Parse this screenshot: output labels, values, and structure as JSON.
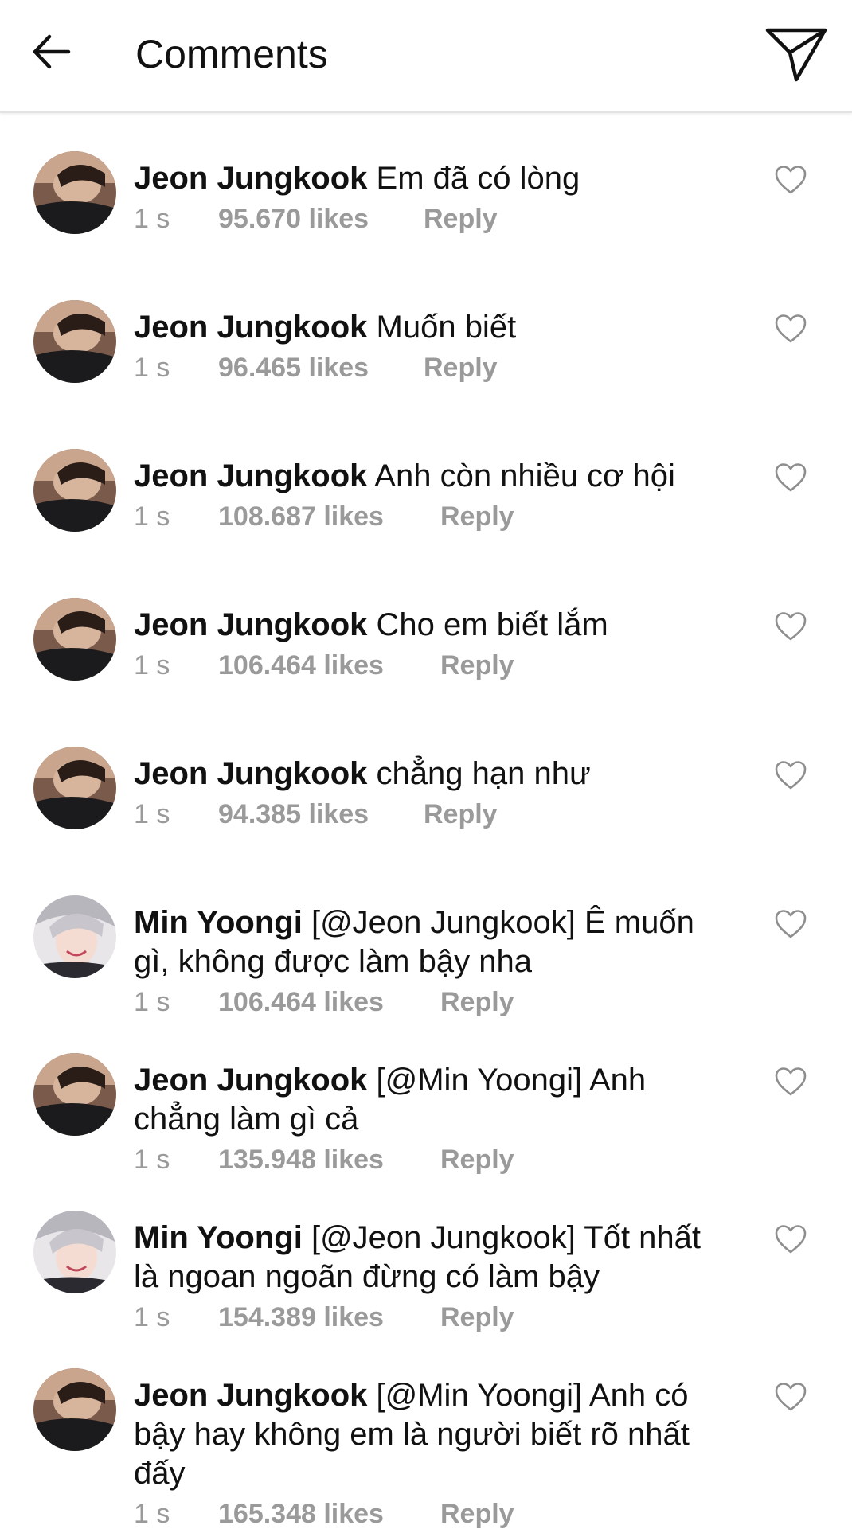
{
  "header": {
    "title": "Comments",
    "back_icon": "arrow-left-icon",
    "send_icon": "paper-plane-icon"
  },
  "colors": {
    "text": "#111111",
    "meta": "#9a9a9a",
    "divider": "#e3e3e3"
  },
  "comments": [
    {
      "username": "Jeon Jungkook",
      "text": "Em đã có lòng",
      "time": "1 s",
      "likes": "95.670 likes",
      "reply": "Reply",
      "avatar": "jungkook-avatar"
    },
    {
      "username": "Jeon Jungkook",
      "text": "Muốn biết",
      "time": "1 s",
      "likes": "96.465 likes",
      "reply": "Reply",
      "avatar": "jungkook-avatar"
    },
    {
      "username": "Jeon Jungkook",
      "text": "Anh còn nhiều cơ hội",
      "time": "1 s",
      "likes": "108.687 likes",
      "reply": "Reply",
      "avatar": "jungkook-avatar"
    },
    {
      "username": "Jeon Jungkook",
      "text": "Cho em biết lắm",
      "time": "1 s",
      "likes": "106.464 likes",
      "reply": "Reply",
      "avatar": "jungkook-avatar"
    },
    {
      "username": "Jeon Jungkook",
      "text": "chẳng hạn như",
      "time": "1 s",
      "likes": "94.385 likes",
      "reply": "Reply",
      "avatar": "jungkook-avatar"
    },
    {
      "username": "Min Yoongi",
      "text": "[@Jeon Jungkook] Ê muốn gì, không được làm bậy nha",
      "time": "1 s",
      "likes": "106.464 likes",
      "reply": "Reply",
      "avatar": "yoongi-avatar"
    },
    {
      "username": "Jeon Jungkook",
      "text": "[@Min Yoongi] Anh chẳng làm gì cả",
      "time": "1 s",
      "likes": "135.948 likes",
      "reply": "Reply",
      "avatar": "jungkook-avatar"
    },
    {
      "username": "Min Yoongi",
      "text": "[@Jeon Jungkook] Tốt nhất là ngoan ngoãn đừng có làm bậy",
      "time": "1 s",
      "likes": "154.389 likes",
      "reply": "Reply",
      "avatar": "yoongi-avatar"
    },
    {
      "username": "Jeon Jungkook",
      "text": "[@Min Yoongi] Anh có bậy hay không em là người biết rõ nhất đấy",
      "time": "1 s",
      "likes": "165.348 likes",
      "reply": "Reply",
      "avatar": "jungkook-avatar"
    }
  ]
}
